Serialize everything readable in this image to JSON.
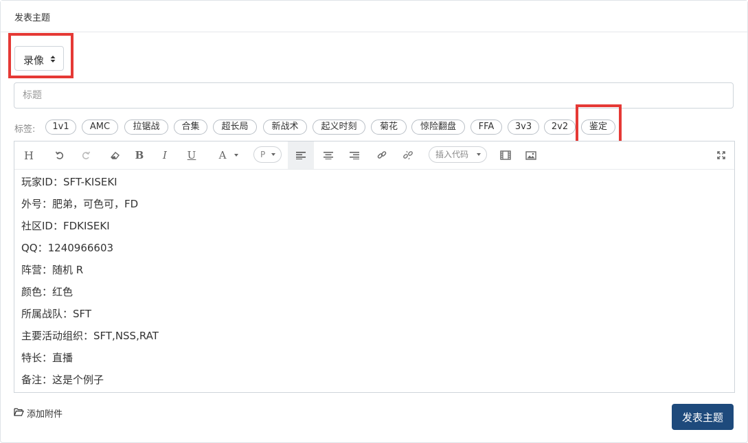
{
  "header": {
    "title": "发表主题"
  },
  "type_select": {
    "value": "录像",
    "options": [
      "录像"
    ]
  },
  "title_input": {
    "placeholder": "标题",
    "value": ""
  },
  "tags": {
    "label": "标签:",
    "items": [
      "1v1",
      "AMC",
      "拉锯战",
      "合集",
      "超长局",
      "新战术",
      "起义时刻",
      "菊花",
      "惊险翻盘",
      "FFA",
      "3v3",
      "2v2",
      "鉴定"
    ]
  },
  "toolbar": {
    "heading_label": "H",
    "bold_label": "B",
    "italic_label": "I",
    "underline_label": "U",
    "font_color_label": "A",
    "paragraph_select": "P",
    "insert_code_select": "插入代码",
    "icons": [
      "heading-icon",
      "undo-icon",
      "redo-icon",
      "eraser-icon",
      "bold-icon",
      "italic-icon",
      "underline-icon",
      "font-color-icon",
      "paragraph-select",
      "align-left-icon",
      "align-center-icon",
      "align-right-icon",
      "link-icon",
      "unlink-icon",
      "insert-code-select",
      "video-icon",
      "image-icon",
      "fullscreen-icon"
    ]
  },
  "editor": {
    "lines": [
      "玩家ID：SFT-KISEKI",
      "外号：肥弟，可色可，FD",
      "社区ID：FDKISEKI",
      "QQ：1240966603",
      "阵营：随机 R",
      "颜色：红色",
      "所属战队：SFT",
      "主要活动组织：SFT,NSS,RAT",
      "特长：直播",
      "备注：这是个例子"
    ]
  },
  "footer": {
    "attach_label": "添加附件",
    "submit_label": "发表主题"
  },
  "colors": {
    "highlight": "#e53935",
    "submit_bg": "#1e4a7c"
  }
}
